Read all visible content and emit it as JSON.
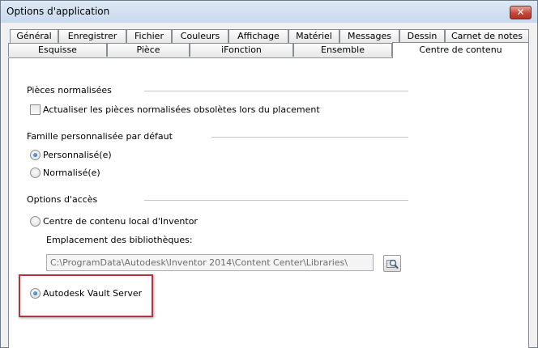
{
  "window": {
    "title": "Options d'application",
    "close_glyph": "✕"
  },
  "tabs_row1": [
    {
      "label": "Général"
    },
    {
      "label": "Enregistrer"
    },
    {
      "label": "Fichier"
    },
    {
      "label": "Couleurs"
    },
    {
      "label": "Affichage"
    },
    {
      "label": "Matériel"
    },
    {
      "label": "Messages"
    },
    {
      "label": "Dessin"
    },
    {
      "label": "Carnet de notes"
    }
  ],
  "tabs_row2": [
    {
      "label": "Esquisse"
    },
    {
      "label": "Pièce"
    },
    {
      "label": "iFonction"
    },
    {
      "label": "Ensemble"
    },
    {
      "label": "Centre de contenu",
      "active": true
    }
  ],
  "sections": {
    "normalized_parts": {
      "title": "Pièces normalisées",
      "refresh_checkbox_label": "Actualiser les pièces normalisées obsolètes lors du placement",
      "refresh_checked": false
    },
    "default_family": {
      "title": "Famille personnalisée par défaut",
      "options": [
        {
          "label": "Personnalisé(e)",
          "selected": true
        },
        {
          "label": "Normalisé(e)",
          "selected": false
        }
      ]
    },
    "access_options": {
      "title": "Options d'accès",
      "local_label": "Centre de contenu local d'Inventor",
      "local_selected": false,
      "library_location_label": "Emplacement des bibliothèques:",
      "library_path": "C:\\ProgramData\\Autodesk\\Inventor 2014\\Content Center\\Libraries\\",
      "vault_label": "Autodesk Vault Server",
      "vault_selected": true
    }
  },
  "colors": {
    "highlight": "#b8343c",
    "radio_selected": "#1c5fb4"
  },
  "icons": {
    "browse": "browse-folder-magnifier-icon",
    "close": "close-icon"
  }
}
